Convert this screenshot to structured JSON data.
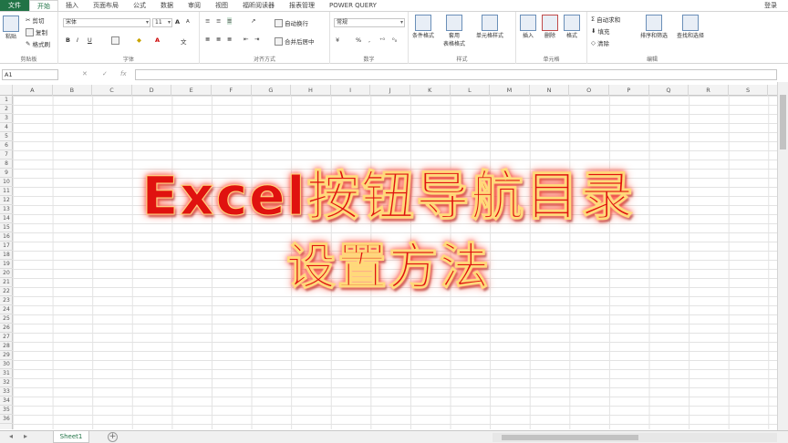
{
  "menu": {
    "tabs": [
      "文件",
      "开始",
      "插入",
      "页面布局",
      "公式",
      "数据",
      "审阅",
      "视图",
      "福昕阅读器",
      "报表管理",
      "POWER QUERY"
    ],
    "login": "登录"
  },
  "ribbon": {
    "clipboard": {
      "paste": "粘贴",
      "cut": "剪切",
      "copy": "复制",
      "format_painter": "格式刷",
      "label": "剪贴板"
    },
    "font": {
      "font_name": "宋体",
      "font_size": "11",
      "bold": "B",
      "italic": "I",
      "underline": "U",
      "grow": "A",
      "shrink": "A",
      "font_color": "A",
      "label": "字体"
    },
    "alignment": {
      "wrap": "自动换行",
      "merge": "合并后居中",
      "label": "对齐方式"
    },
    "number": {
      "format": "常规",
      "percent": "%",
      "comma": ",",
      "label": "数字"
    },
    "styles": {
      "conditional": "条件格式",
      "table": "套用\n表格格式",
      "cell_styles": "单元格样式",
      "label": "样式"
    },
    "cells": {
      "insert": "插入",
      "delete": "删除",
      "format": "格式",
      "label": "单元格"
    },
    "editing": {
      "autosum": "自动求和",
      "fill": "填充",
      "clear": "清除",
      "sort": "排序和筛选",
      "find": "查找和选择",
      "label": "编辑"
    }
  },
  "formula_bar": {
    "name_box": "A1",
    "cancel": "✕",
    "confirm": "✓",
    "fx": "fx",
    "value": ""
  },
  "grid": {
    "columns": [
      "A",
      "B",
      "C",
      "D",
      "E",
      "F",
      "G",
      "H",
      "I",
      "J",
      "K",
      "L",
      "M",
      "N",
      "O",
      "P",
      "Q",
      "R",
      "S"
    ],
    "rows": [
      "1",
      "2",
      "3",
      "4",
      "5",
      "6",
      "7",
      "8",
      "9",
      "10",
      "11",
      "12",
      "13",
      "14",
      "15",
      "16",
      "17",
      "18",
      "19",
      "20",
      "21",
      "22",
      "23",
      "24",
      "25",
      "26",
      "27",
      "28",
      "29",
      "30",
      "31",
      "32",
      "33",
      "34",
      "35",
      "36"
    ]
  },
  "overlay": {
    "line1": "Excel按钮导航目录",
    "line2": "设置方法"
  },
  "sheets": {
    "active": "Sheet1",
    "add": "+"
  },
  "colors": {
    "excel_green": "#217346",
    "title_red": "#e0120f"
  }
}
